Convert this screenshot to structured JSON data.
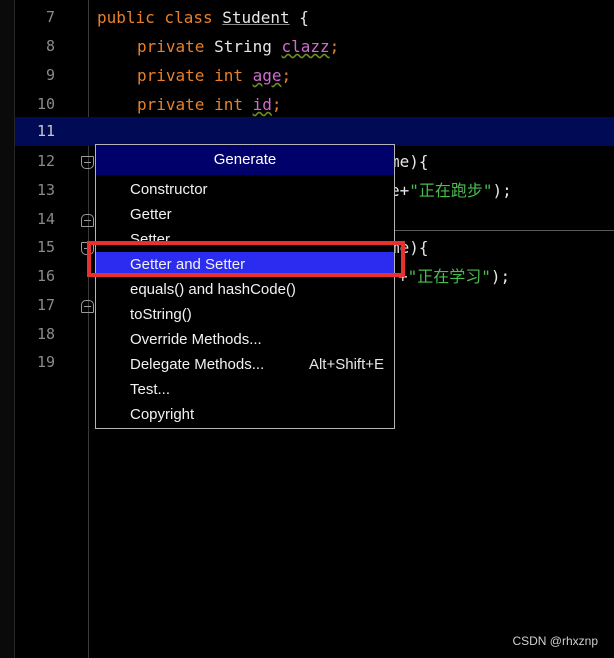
{
  "editor": {
    "lines": [
      {
        "num": "7"
      },
      {
        "num": "8"
      },
      {
        "num": "9"
      },
      {
        "num": "10"
      },
      {
        "num": "11"
      },
      {
        "num": "12"
      },
      {
        "num": "13"
      },
      {
        "num": "14"
      },
      {
        "num": "15"
      },
      {
        "num": "16"
      },
      {
        "num": "17"
      },
      {
        "num": "18"
      },
      {
        "num": "19"
      }
    ],
    "code": {
      "l7_kw": "public class ",
      "l7_class": "Student",
      "l7_brace": " {",
      "l8_kw": "private ",
      "l8_type": "String ",
      "l8_field": "clazz",
      "l8_semi": ";",
      "l9_kw": "private int ",
      "l9_field": "age",
      "l9_semi": ";",
      "l10_kw": "private int ",
      "l10_field": "id",
      "l10_semi": ";",
      "l12_tail": "me){",
      "l13_pre": "e+",
      "l13_str": "\"正在跑步\"",
      "l13_post": ");",
      "l15_tail": "me){",
      "l16_pre": "+",
      "l16_str": "\"正在学习\"",
      "l16_post": ");"
    }
  },
  "popup": {
    "title": "Generate",
    "items": [
      {
        "label": "Constructor",
        "shortcut": ""
      },
      {
        "label": "Getter",
        "shortcut": ""
      },
      {
        "label": "Setter",
        "shortcut": ""
      },
      {
        "label": "Getter and Setter",
        "shortcut": "",
        "selected": true
      },
      {
        "label": "equals() and hashCode()",
        "shortcut": ""
      },
      {
        "label": "toString()",
        "shortcut": ""
      },
      {
        "label": "Override Methods...",
        "shortcut": ""
      },
      {
        "label": "Delegate Methods...",
        "shortcut": "Alt+Shift+E"
      },
      {
        "label": "Test...",
        "shortcut": ""
      },
      {
        "label": "Copyright",
        "shortcut": ""
      }
    ]
  },
  "watermark": "CSDN @rhxznp",
  "colors": {
    "keyword": "#e8802a",
    "field": "#d06ccf",
    "string": "#4bbd4f",
    "current_line": "#000a55",
    "popup_title_bg": "#00006b",
    "selected_item": "#2c2cf0",
    "annotation_box": "#e8312f"
  }
}
